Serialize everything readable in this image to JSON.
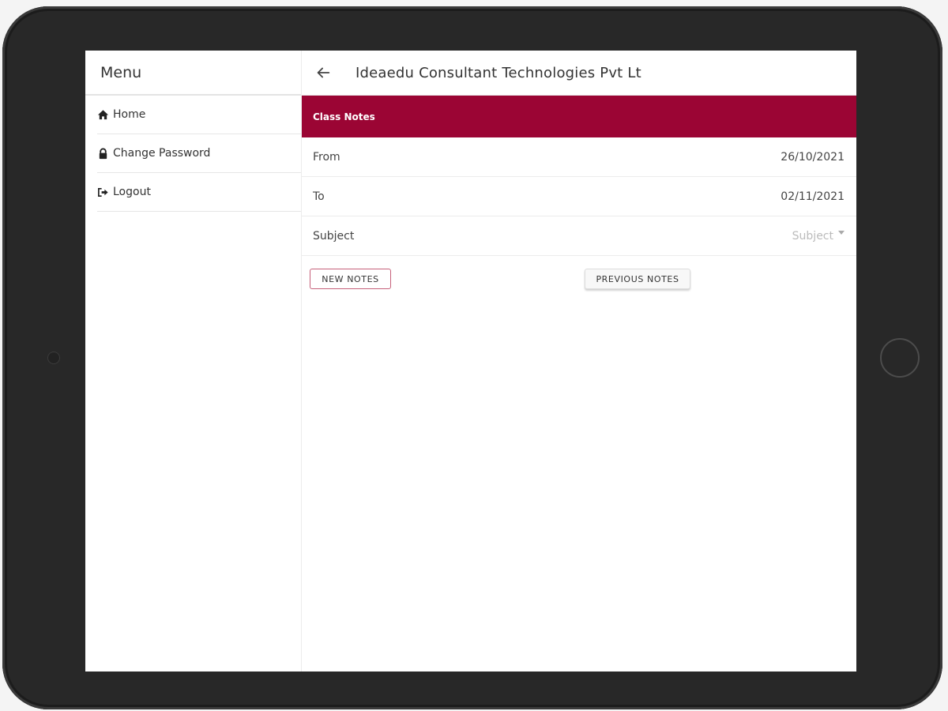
{
  "sidebar": {
    "title": "Menu",
    "items": [
      {
        "label": "Home",
        "icon": "home-icon"
      },
      {
        "label": "Change Password",
        "icon": "lock-icon"
      },
      {
        "label": "Logout",
        "icon": "logout-icon"
      }
    ]
  },
  "header": {
    "title": "Ideaedu Consultant Technologies Pvt Lt"
  },
  "banner": {
    "title": "Class Notes"
  },
  "form": {
    "from": {
      "label": "From",
      "value": "26/10/2021"
    },
    "to": {
      "label": "To",
      "value": "02/11/2021"
    },
    "subject": {
      "label": "Subject",
      "placeholder": "Subject"
    }
  },
  "buttons": {
    "new_notes": "NEW NOTES",
    "previous_notes": "PREVIOUS NOTES"
  },
  "colors": {
    "banner": "#9b0534",
    "device_frame": "#282828"
  }
}
